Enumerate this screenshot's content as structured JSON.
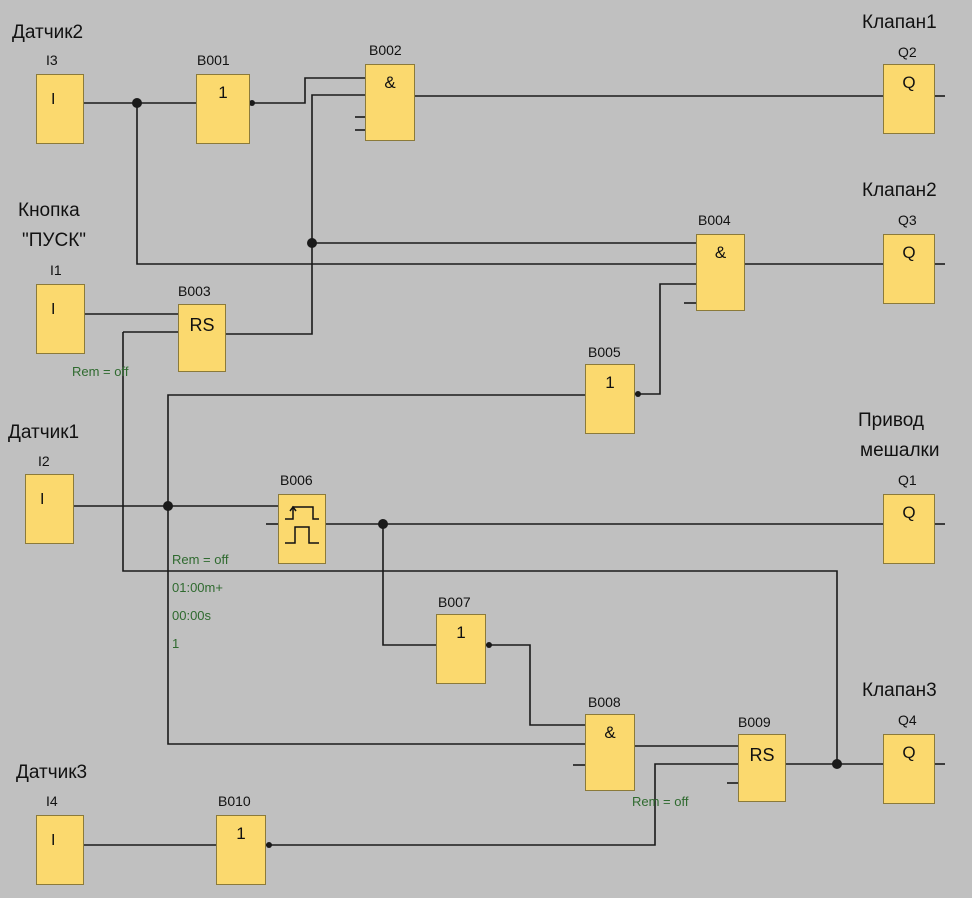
{
  "blocks": {
    "i3": {
      "name": "Датчик2",
      "id": "I3",
      "sym": "I"
    },
    "i1": {
      "name_line1": "Кнопка",
      "name_line2": "\"ПУСК\"",
      "id": "I1",
      "sym": "I"
    },
    "i2": {
      "name": "Датчик1",
      "id": "I2",
      "sym": "I"
    },
    "i4": {
      "name": "Датчик3",
      "id": "I4",
      "sym": "I"
    },
    "b001": {
      "id": "B001",
      "sym": "1"
    },
    "b002": {
      "id": "B002",
      "sym": "&"
    },
    "b003": {
      "id": "B003",
      "sym": "RS",
      "param": "Rem = off"
    },
    "b004": {
      "id": "B004",
      "sym": "&"
    },
    "b005": {
      "id": "B005",
      "sym": "1"
    },
    "b006": {
      "id": "B006",
      "params": [
        "Rem = off",
        "01:00m+",
        "00:00s",
        "1"
      ]
    },
    "b007": {
      "id": "B007",
      "sym": "1"
    },
    "b008": {
      "id": "B008",
      "sym": "&"
    },
    "b009": {
      "id": "B009",
      "sym": "RS",
      "param": "Rem = off"
    },
    "b010": {
      "id": "B010",
      "sym": "1"
    },
    "q2": {
      "name": "Клапан1",
      "id": "Q2",
      "sym": "Q"
    },
    "q3": {
      "name": "Клапан2",
      "id": "Q3",
      "sym": "Q"
    },
    "q1": {
      "name_line1": "Привод",
      "name_line2": "мешалки",
      "id": "Q1",
      "sym": "Q"
    },
    "q4": {
      "name": "Клапан3",
      "id": "Q4",
      "sym": "Q"
    }
  },
  "colors": {
    "background": "#c0c0c0",
    "block_fill": "#fbd96e",
    "wire": "#1a1a1a",
    "param_text": "#2f6a2f"
  }
}
